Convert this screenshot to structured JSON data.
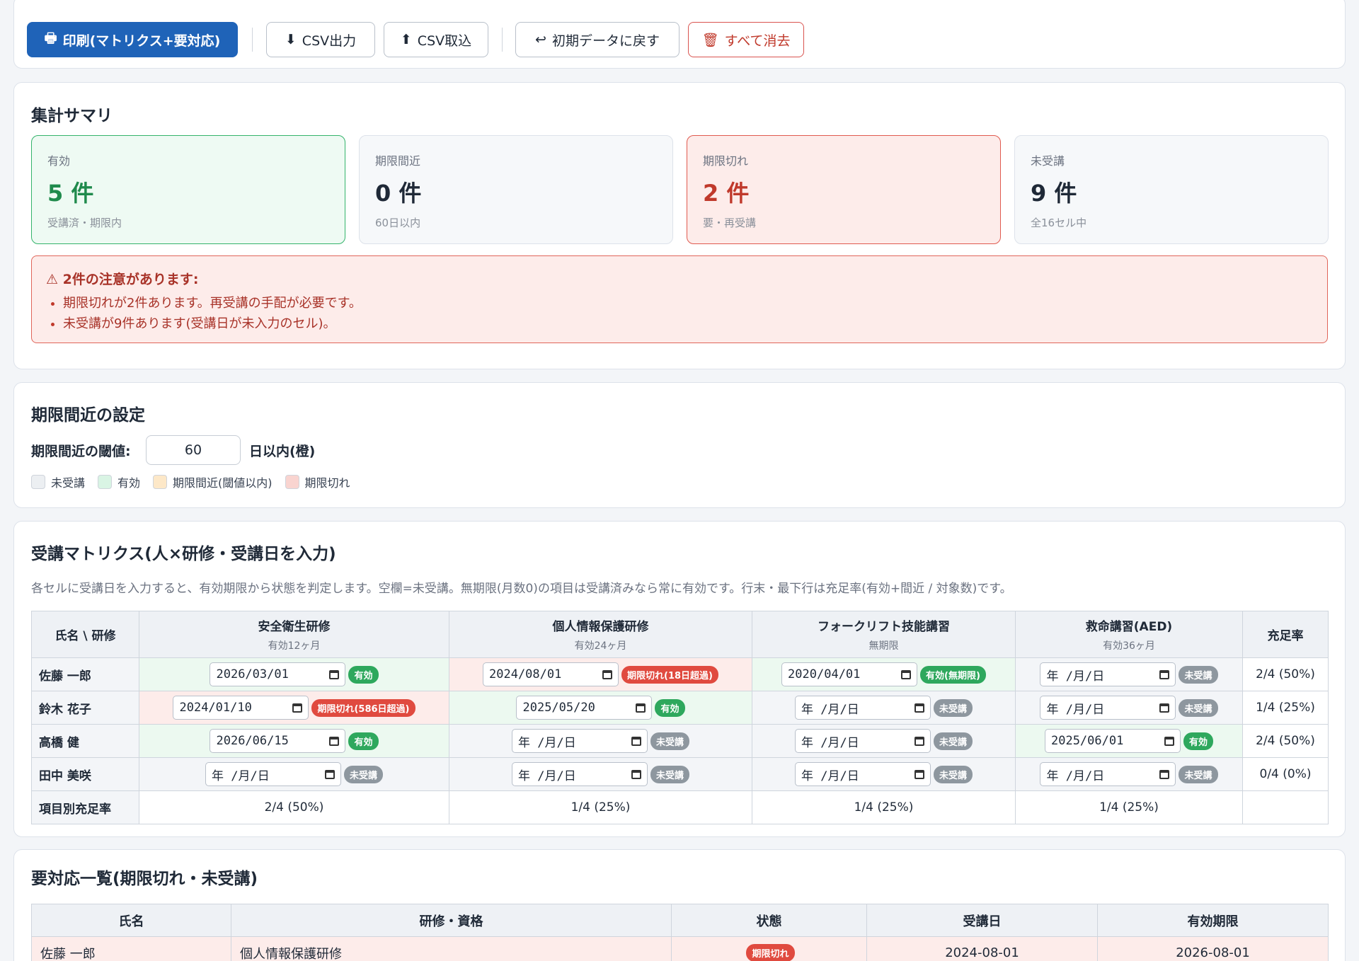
{
  "toolbar": {
    "print": "印刷(マトリクス+要対応)",
    "csv_export": "CSV出力",
    "csv_import": "CSV取込",
    "reset": "初期データに戻す",
    "clear": "すべて消去"
  },
  "summary": {
    "title": "集計サマリ",
    "stats": [
      {
        "label": "有効",
        "value": "5 件",
        "sub": "受講済・期限内"
      },
      {
        "label": "期限間近",
        "value": "0 件",
        "sub": "60日以内"
      },
      {
        "label": "期限切れ",
        "value": "2 件",
        "sub": "要・再受講"
      },
      {
        "label": "未受講",
        "value": "9 件",
        "sub": "全16セル中"
      }
    ],
    "alert": {
      "title": "2件の注意があります:",
      "items": [
        "期限切れが2件あります。再受講の手配が必要です。",
        "未受講が9件あります(受講日が未入力のセル)。"
      ]
    }
  },
  "threshold": {
    "title": "期限間近の設定",
    "label": "期限間近の閾値:",
    "value": "60",
    "unit": "日以内(橙)",
    "legend": [
      "未受講",
      "有効",
      "期限間近(閾値以内)",
      "期限切れ"
    ],
    "legend_colors": [
      "#eceff2",
      "#d9f4e4",
      "#fde8c8",
      "#f9d4d0"
    ]
  },
  "matrix": {
    "title": "受講マトリクス(人×研修・受講日を入力)",
    "description": "各セルに受講日を入力すると、有効期限から状態を判定します。空欄=未受講。無期限(月数0)の項目は受講済みなら常に有効です。行末・最下行は充足率(有効+間近 / 対象数)です。",
    "corner": "氏名 \\ 研修",
    "rate_header": "充足率",
    "columns": [
      {
        "name": "安全衛生研修",
        "period": "有効12ヶ月"
      },
      {
        "name": "個人情報保護研修",
        "period": "有効24ヶ月"
      },
      {
        "name": "フォークリフト技能講習",
        "period": "無期限"
      },
      {
        "name": "救命講習(AED)",
        "period": "有効36ヶ月"
      }
    ],
    "rows": [
      {
        "name": "佐藤 一郎",
        "rate": "2/4 (50%)",
        "cells": [
          {
            "date": "2026/03/01",
            "badge": "有効",
            "status": "ok"
          },
          {
            "date": "2024/08/01",
            "badge": "期限切れ(18日超過)",
            "status": "ng"
          },
          {
            "date": "2020/04/01",
            "badge": "有効(無期限)",
            "status": "ok"
          },
          {
            "date": "年 /月/日",
            "badge": "未受講",
            "status": "no"
          }
        ]
      },
      {
        "name": "鈴木 花子",
        "rate": "1/4 (25%)",
        "cells": [
          {
            "date": "2024/01/10",
            "badge": "期限切れ(586日超過)",
            "status": "ng"
          },
          {
            "date": "2025/05/20",
            "badge": "有効",
            "status": "ok"
          },
          {
            "date": "年 /月/日",
            "badge": "未受講",
            "status": "no"
          },
          {
            "date": "年 /月/日",
            "badge": "未受講",
            "status": "no"
          }
        ]
      },
      {
        "name": "高橋 健",
        "rate": "2/4 (50%)",
        "cells": [
          {
            "date": "2026/06/15",
            "badge": "有効",
            "status": "ok"
          },
          {
            "date": "年 /月/日",
            "badge": "未受講",
            "status": "no"
          },
          {
            "date": "年 /月/日",
            "badge": "未受講",
            "status": "no"
          },
          {
            "date": "2025/06/01",
            "badge": "有効",
            "status": "ok"
          }
        ]
      },
      {
        "name": "田中 美咲",
        "rate": "0/4 (0%)",
        "cells": [
          {
            "date": "年 /月/日",
            "badge": "未受講",
            "status": "no"
          },
          {
            "date": "年 /月/日",
            "badge": "未受講",
            "status": "no"
          },
          {
            "date": "年 /月/日",
            "badge": "未受講",
            "status": "no"
          },
          {
            "date": "年 /月/日",
            "badge": "未受講",
            "status": "no"
          }
        ]
      }
    ],
    "summary_row": {
      "label": "項目別充足率",
      "values": [
        "2/4 (50%)",
        "1/4 (25%)",
        "1/4 (25%)",
        "1/4 (25%)"
      ]
    }
  },
  "todo": {
    "title": "要対応一覧(期限切れ・未受講)",
    "headers": [
      "氏名",
      "研修・資格",
      "状態",
      "受講日",
      "有効期限"
    ],
    "rows": [
      {
        "name": "佐藤 一郎",
        "course": "個人情報保護研修",
        "status": "期限切れ",
        "date": "2024-08-01",
        "expiry": "2026-08-01"
      }
    ]
  },
  "icons": {
    "print": "printer-icon",
    "export": "download-arrow-icon",
    "import": "upload-arrow-icon",
    "reset": "return-arrow-icon",
    "clear": "trash-icon",
    "warning": "warning-icon"
  }
}
